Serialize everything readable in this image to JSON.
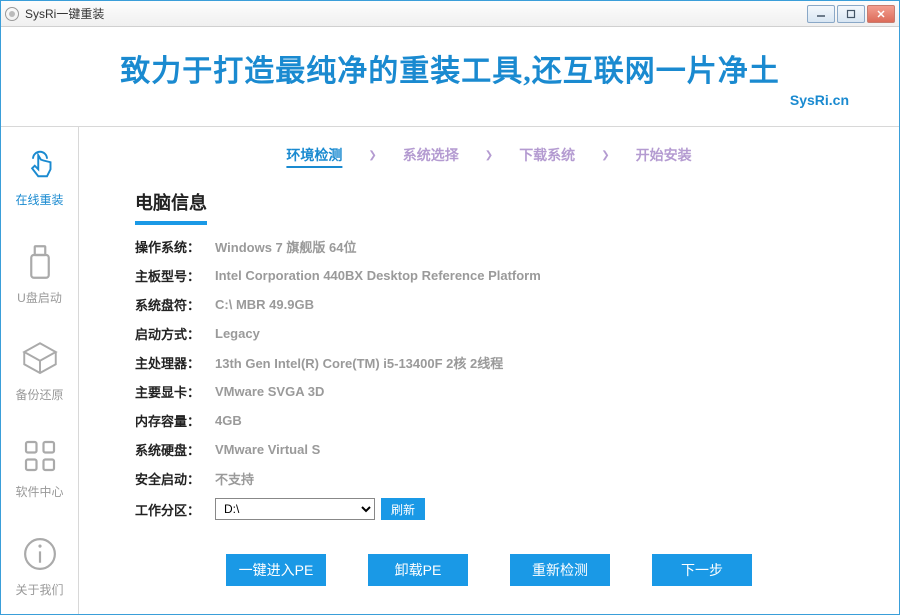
{
  "titlebar": {
    "title": "SysRi一键重装"
  },
  "banner": {
    "title": "致力于打造最纯净的重装工具,还互联网一片净土",
    "subtitle": "SysRi.cn"
  },
  "sidebar": {
    "items": [
      {
        "label": "在线重装"
      },
      {
        "label": "U盘启动"
      },
      {
        "label": "备份还原"
      },
      {
        "label": "软件中心"
      },
      {
        "label": "关于我们"
      }
    ]
  },
  "steps": {
    "items": [
      {
        "label": "环境检测"
      },
      {
        "label": "系统选择"
      },
      {
        "label": "下载系统"
      },
      {
        "label": "开始安装"
      }
    ]
  },
  "section": {
    "title": "电脑信息"
  },
  "info": {
    "os": {
      "label": "操作系统：",
      "value": "Windows 7 旗舰版   64位"
    },
    "board": {
      "label": "主板型号：",
      "value": "Intel Corporation 440BX Desktop Reference Platform"
    },
    "drive": {
      "label": "系统盘符：",
      "value": "C:\\ MBR 49.9GB"
    },
    "boot": {
      "label": "启动方式：",
      "value": "Legacy"
    },
    "cpu": {
      "label": "主处理器：",
      "value": "13th Gen Intel(R) Core(TM) i5-13400F 2核 2线程"
    },
    "gpu": {
      "label": "主要显卡：",
      "value": "VMware SVGA 3D"
    },
    "ram": {
      "label": "内存容量：",
      "value": "4GB"
    },
    "disk": {
      "label": "系统硬盘：",
      "value": "VMware Virtual S"
    },
    "secure": {
      "label": "安全启动：",
      "value": "不支持"
    },
    "workpart": {
      "label": "工作分区：",
      "selected": "D:\\",
      "refresh": "刷新"
    }
  },
  "actions": {
    "pe_enter": "一键进入PE",
    "pe_unload": "卸载PE",
    "recheck": "重新检测",
    "next": "下一步"
  }
}
